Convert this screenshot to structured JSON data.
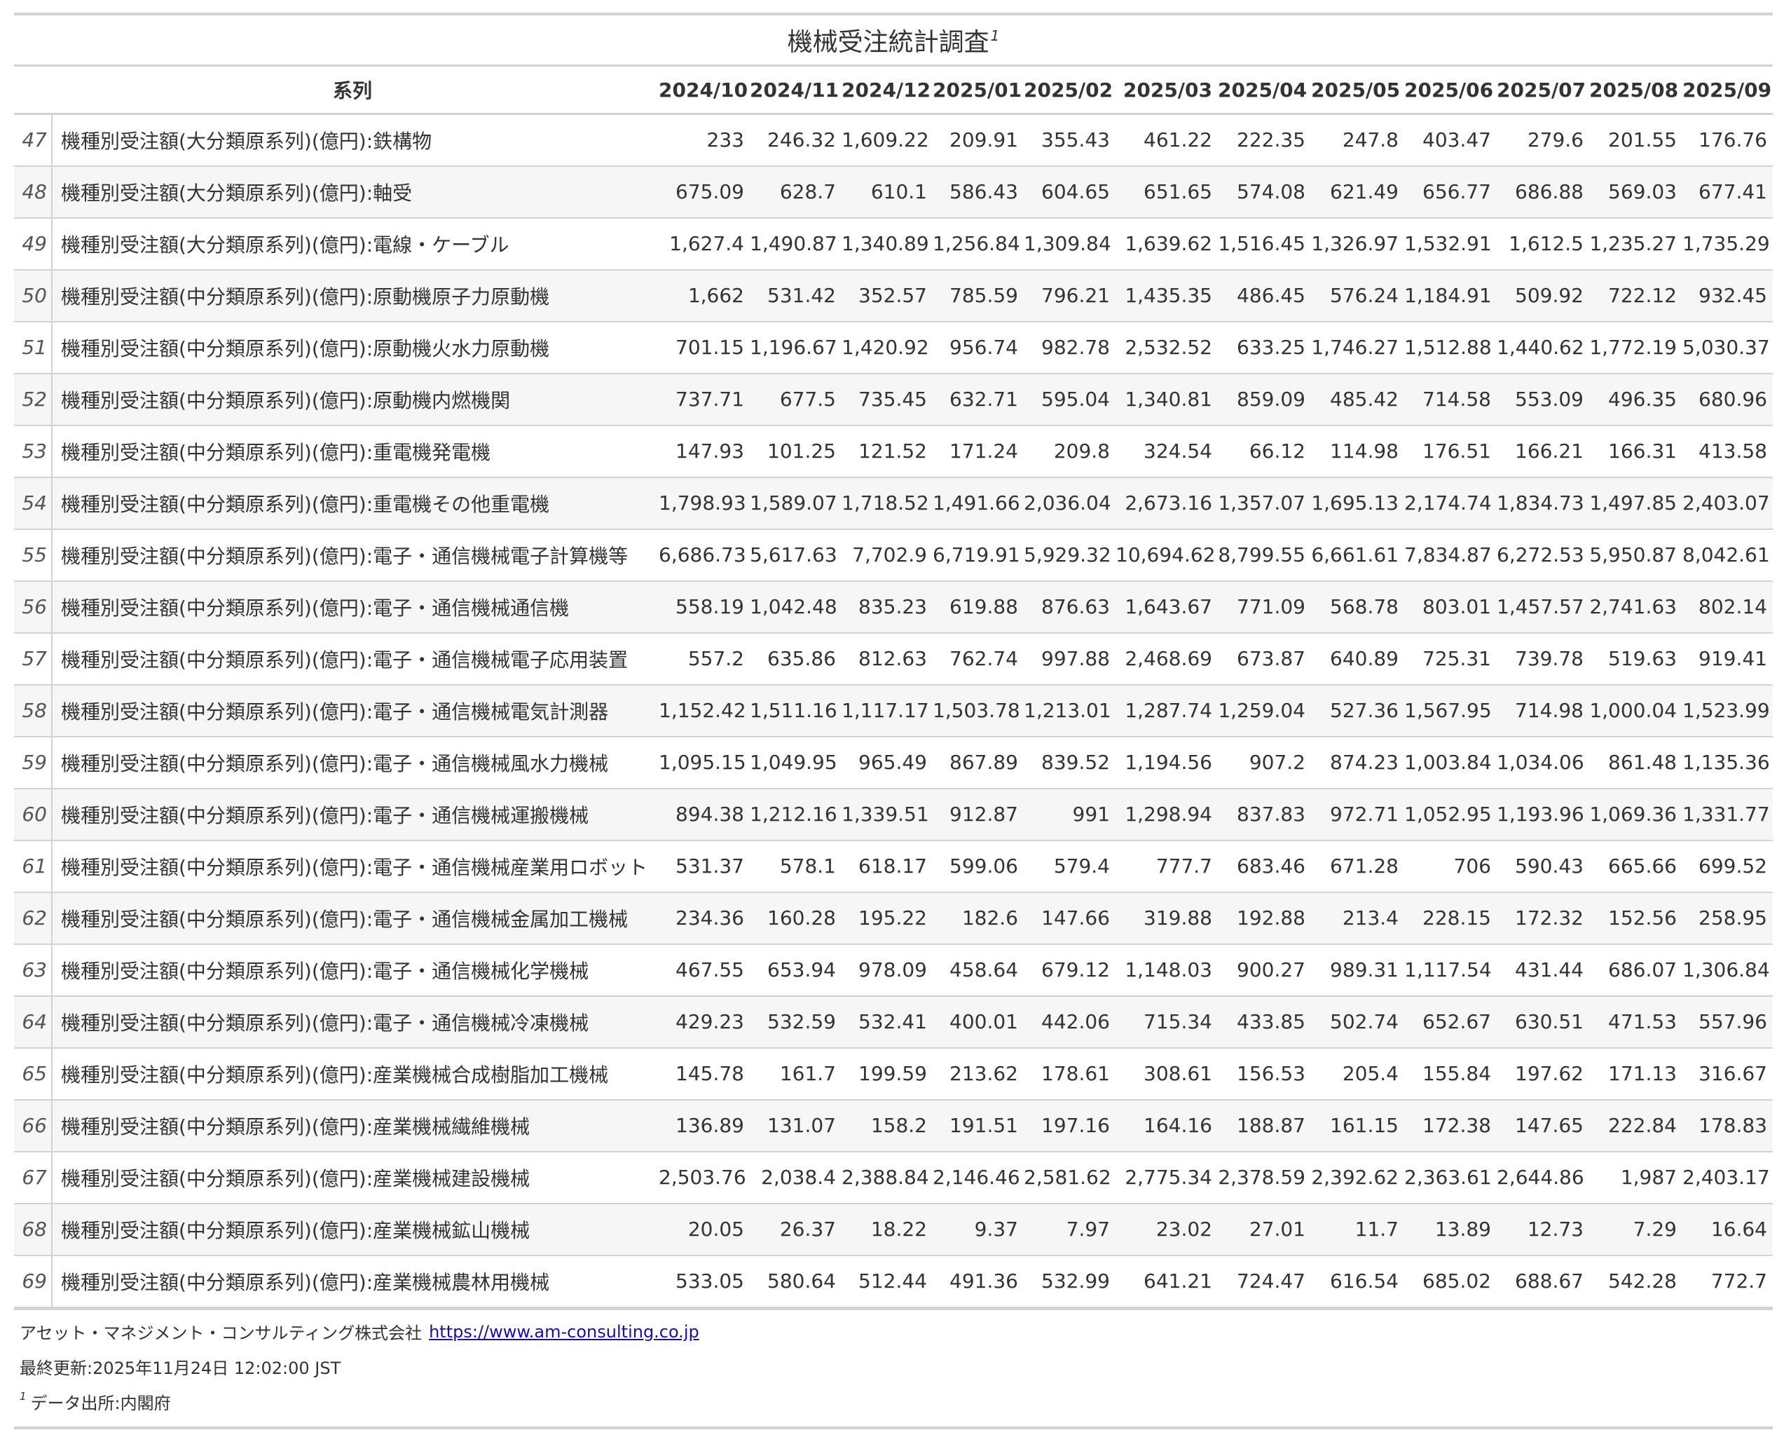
{
  "title": "機械受注統計調査",
  "title_footnote_mark": "1",
  "columns": {
    "series_header": "系列",
    "periods": [
      "2024/10",
      "2024/11",
      "2024/12",
      "2025/01",
      "2025/02",
      "2025/03",
      "2025/04",
      "2025/05",
      "2025/06",
      "2025/07",
      "2025/08",
      "2025/09"
    ]
  },
  "rows": [
    {
      "idx": "47",
      "name": "機種別受注額(大分類原系列)(億円):鉄構物",
      "values": [
        "233",
        "246.32",
        "1,609.22",
        "209.91",
        "355.43",
        "461.22",
        "222.35",
        "247.8",
        "403.47",
        "279.6",
        "201.55",
        "176.76"
      ]
    },
    {
      "idx": "48",
      "name": "機種別受注額(大分類原系列)(億円):軸受",
      "values": [
        "675.09",
        "628.7",
        "610.1",
        "586.43",
        "604.65",
        "651.65",
        "574.08",
        "621.49",
        "656.77",
        "686.88",
        "569.03",
        "677.41"
      ]
    },
    {
      "idx": "49",
      "name": "機種別受注額(大分類原系列)(億円):電線・ケーブル",
      "values": [
        "1,627.4",
        "1,490.87",
        "1,340.89",
        "1,256.84",
        "1,309.84",
        "1,639.62",
        "1,516.45",
        "1,326.97",
        "1,532.91",
        "1,612.5",
        "1,235.27",
        "1,735.29"
      ]
    },
    {
      "idx": "50",
      "name": "機種別受注額(中分類原系列)(億円):原動機原子力原動機",
      "values": [
        "1,662",
        "531.42",
        "352.57",
        "785.59",
        "796.21",
        "1,435.35",
        "486.45",
        "576.24",
        "1,184.91",
        "509.92",
        "722.12",
        "932.45"
      ]
    },
    {
      "idx": "51",
      "name": "機種別受注額(中分類原系列)(億円):原動機火水力原動機",
      "values": [
        "701.15",
        "1,196.67",
        "1,420.92",
        "956.74",
        "982.78",
        "2,532.52",
        "633.25",
        "1,746.27",
        "1,512.88",
        "1,440.62",
        "1,772.19",
        "5,030.37"
      ]
    },
    {
      "idx": "52",
      "name": "機種別受注額(中分類原系列)(億円):原動機内燃機関",
      "values": [
        "737.71",
        "677.5",
        "735.45",
        "632.71",
        "595.04",
        "1,340.81",
        "859.09",
        "485.42",
        "714.58",
        "553.09",
        "496.35",
        "680.96"
      ]
    },
    {
      "idx": "53",
      "name": "機種別受注額(中分類原系列)(億円):重電機発電機",
      "values": [
        "147.93",
        "101.25",
        "121.52",
        "171.24",
        "209.8",
        "324.54",
        "66.12",
        "114.98",
        "176.51",
        "166.21",
        "166.31",
        "413.58"
      ]
    },
    {
      "idx": "54",
      "name": "機種別受注額(中分類原系列)(億円):重電機その他重電機",
      "values": [
        "1,798.93",
        "1,589.07",
        "1,718.52",
        "1,491.66",
        "2,036.04",
        "2,673.16",
        "1,357.07",
        "1,695.13",
        "2,174.74",
        "1,834.73",
        "1,497.85",
        "2,403.07"
      ]
    },
    {
      "idx": "55",
      "name": "機種別受注額(中分類原系列)(億円):電子・通信機械電子計算機等",
      "values": [
        "6,686.73",
        "5,617.63",
        "7,702.9",
        "6,719.91",
        "5,929.32",
        "10,694.62",
        "8,799.55",
        "6,661.61",
        "7,834.87",
        "6,272.53",
        "5,950.87",
        "8,042.61"
      ]
    },
    {
      "idx": "56",
      "name": "機種別受注額(中分類原系列)(億円):電子・通信機械通信機",
      "values": [
        "558.19",
        "1,042.48",
        "835.23",
        "619.88",
        "876.63",
        "1,643.67",
        "771.09",
        "568.78",
        "803.01",
        "1,457.57",
        "2,741.63",
        "802.14"
      ]
    },
    {
      "idx": "57",
      "name": "機種別受注額(中分類原系列)(億円):電子・通信機械電子応用装置",
      "values": [
        "557.2",
        "635.86",
        "812.63",
        "762.74",
        "997.88",
        "2,468.69",
        "673.87",
        "640.89",
        "725.31",
        "739.78",
        "519.63",
        "919.41"
      ]
    },
    {
      "idx": "58",
      "name": "機種別受注額(中分類原系列)(億円):電子・通信機械電気計測器",
      "values": [
        "1,152.42",
        "1,511.16",
        "1,117.17",
        "1,503.78",
        "1,213.01",
        "1,287.74",
        "1,259.04",
        "527.36",
        "1,567.95",
        "714.98",
        "1,000.04",
        "1,523.99"
      ]
    },
    {
      "idx": "59",
      "name": "機種別受注額(中分類原系列)(億円):電子・通信機械風水力機械",
      "values": [
        "1,095.15",
        "1,049.95",
        "965.49",
        "867.89",
        "839.52",
        "1,194.56",
        "907.2",
        "874.23",
        "1,003.84",
        "1,034.06",
        "861.48",
        "1,135.36"
      ]
    },
    {
      "idx": "60",
      "name": "機種別受注額(中分類原系列)(億円):電子・通信機械運搬機械",
      "values": [
        "894.38",
        "1,212.16",
        "1,339.51",
        "912.87",
        "991",
        "1,298.94",
        "837.83",
        "972.71",
        "1,052.95",
        "1,193.96",
        "1,069.36",
        "1,331.77"
      ]
    },
    {
      "idx": "61",
      "name": "機種別受注額(中分類原系列)(億円):電子・通信機械産業用ロボット",
      "values": [
        "531.37",
        "578.1",
        "618.17",
        "599.06",
        "579.4",
        "777.7",
        "683.46",
        "671.28",
        "706",
        "590.43",
        "665.66",
        "699.52"
      ]
    },
    {
      "idx": "62",
      "name": "機種別受注額(中分類原系列)(億円):電子・通信機械金属加工機械",
      "values": [
        "234.36",
        "160.28",
        "195.22",
        "182.6",
        "147.66",
        "319.88",
        "192.88",
        "213.4",
        "228.15",
        "172.32",
        "152.56",
        "258.95"
      ]
    },
    {
      "idx": "63",
      "name": "機種別受注額(中分類原系列)(億円):電子・通信機械化学機械",
      "values": [
        "467.55",
        "653.94",
        "978.09",
        "458.64",
        "679.12",
        "1,148.03",
        "900.27",
        "989.31",
        "1,117.54",
        "431.44",
        "686.07",
        "1,306.84"
      ]
    },
    {
      "idx": "64",
      "name": "機種別受注額(中分類原系列)(億円):電子・通信機械冷凍機械",
      "values": [
        "429.23",
        "532.59",
        "532.41",
        "400.01",
        "442.06",
        "715.34",
        "433.85",
        "502.74",
        "652.67",
        "630.51",
        "471.53",
        "557.96"
      ]
    },
    {
      "idx": "65",
      "name": "機種別受注額(中分類原系列)(億円):産業機械合成樹脂加工機械",
      "values": [
        "145.78",
        "161.7",
        "199.59",
        "213.62",
        "178.61",
        "308.61",
        "156.53",
        "205.4",
        "155.84",
        "197.62",
        "171.13",
        "316.67"
      ]
    },
    {
      "idx": "66",
      "name": "機種別受注額(中分類原系列)(億円):産業機械繊維機械",
      "values": [
        "136.89",
        "131.07",
        "158.2",
        "191.51",
        "197.16",
        "164.16",
        "188.87",
        "161.15",
        "172.38",
        "147.65",
        "222.84",
        "178.83"
      ]
    },
    {
      "idx": "67",
      "name": "機種別受注額(中分類原系列)(億円):産業機械建設機械",
      "values": [
        "2,503.76",
        "2,038.4",
        "2,388.84",
        "2,146.46",
        "2,581.62",
        "2,775.34",
        "2,378.59",
        "2,392.62",
        "2,363.61",
        "2,644.86",
        "1,987",
        "2,403.17"
      ]
    },
    {
      "idx": "68",
      "name": "機種別受注額(中分類原系列)(億円):産業機械鉱山機械",
      "values": [
        "20.05",
        "26.37",
        "18.22",
        "9.37",
        "7.97",
        "23.02",
        "27.01",
        "11.7",
        "13.89",
        "12.73",
        "7.29",
        "16.64"
      ]
    },
    {
      "idx": "69",
      "name": "機種別受注額(中分類原系列)(億円):産業機械農林用機械",
      "values": [
        "533.05",
        "580.64",
        "512.44",
        "491.36",
        "532.99",
        "641.21",
        "724.47",
        "616.54",
        "685.02",
        "688.67",
        "542.28",
        "772.7"
      ]
    }
  ],
  "footer": {
    "company": "アセット・マネジメント・コンサルティング株式会社",
    "url": "https://www.am-consulting.co.jp",
    "updated": "最終更新:2025年11月24日 12:02:00 JST",
    "source_mark": "1",
    "source": "データ出所:内閣府"
  }
}
